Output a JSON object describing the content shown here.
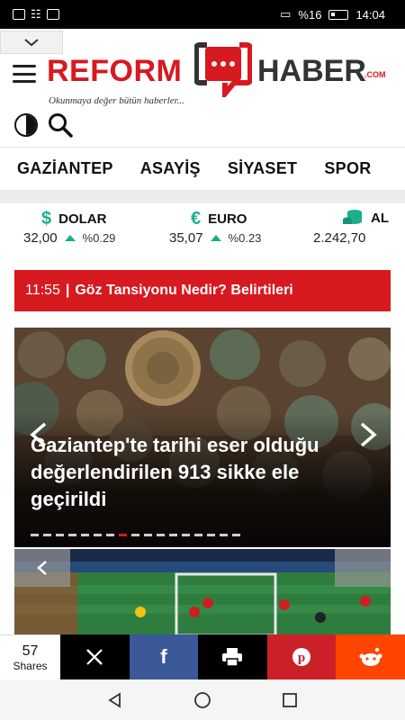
{
  "status_bar": {
    "battery_pct": "%16",
    "time": "14:04"
  },
  "logo": {
    "name_left": "REFORM",
    "name_right": "HABER",
    "suffix": ".COM",
    "tagline": "Okunmaya değer bütün haberler..."
  },
  "nav": {
    "items": [
      "GAZİANTEP",
      "ASAYİŞ",
      "SİYASET",
      "SPOR"
    ]
  },
  "currency": [
    {
      "name": "DOLAR",
      "value": "32,00",
      "change": "%0.29",
      "direction": "up",
      "icon": "dollar-icon"
    },
    {
      "name": "EURO",
      "value": "35,07",
      "change": "%0.23",
      "direction": "up",
      "icon": "euro-icon"
    },
    {
      "name": "ALTIN",
      "name_visible": "AL",
      "value": "2.242,70",
      "icon": "gold-coins-icon"
    }
  ],
  "ticker": {
    "time": "11:55",
    "separator": "|",
    "title": "Göz Tansiyonu Nedir? Belirtileri"
  },
  "slider": {
    "title": "Gaziantep'te tarihi eser olduğu değerlendirilen 913 sikke ele geçirildi",
    "dot_count": 17,
    "active_dot": 7
  },
  "share": {
    "count": "57",
    "label": "Shares",
    "buttons": [
      "x",
      "facebook",
      "print",
      "pinterest",
      "reddit"
    ]
  },
  "colors": {
    "brand_red": "#d71920",
    "accent_green": "#1bb08a",
    "facebook": "#3b5998",
    "pinterest": "#cb2027",
    "reddit": "#ff4500"
  }
}
